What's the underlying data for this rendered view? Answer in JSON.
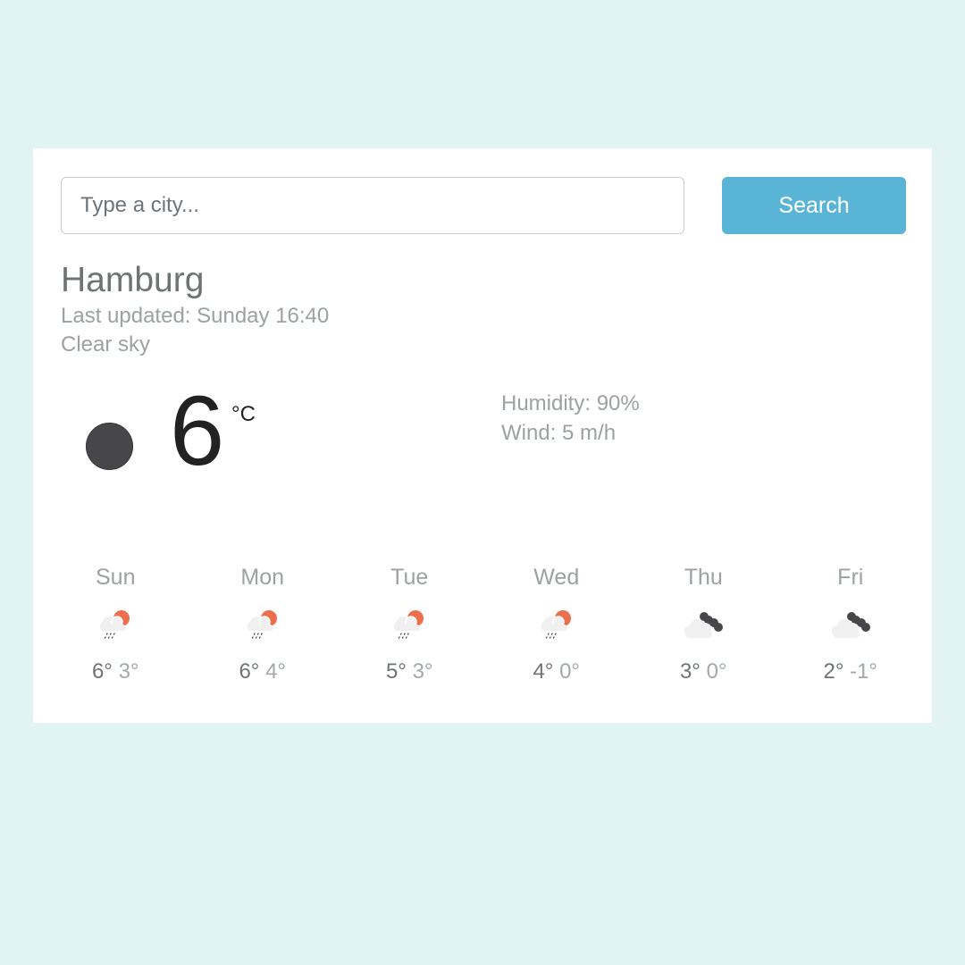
{
  "search": {
    "placeholder": "Type a city...",
    "button_label": "Search"
  },
  "current": {
    "city": "Hamburg",
    "last_updated": "Last updated: Sunday 16:40",
    "description": "Clear sky",
    "icon": "moon-clear-night-icon",
    "temperature": "6",
    "unit": "°C",
    "humidity": "Humidity: 90%",
    "wind": "Wind: 5 m/h"
  },
  "colors": {
    "background": "#e1f4f3",
    "button": "#5ab4d6",
    "sun": "#ec6e4c",
    "dark_cloud": "#474749",
    "light_cloud": "#f0f0f0"
  },
  "forecast": [
    {
      "day": "Sun",
      "max": "6°",
      "min": "3°",
      "icon": "rain-sun-icon"
    },
    {
      "day": "Mon",
      "max": "6°",
      "min": "4°",
      "icon": "rain-sun-icon"
    },
    {
      "day": "Tue",
      "max": "5°",
      "min": "3°",
      "icon": "rain-sun-icon"
    },
    {
      "day": "Wed",
      "max": "4°",
      "min": "0°",
      "icon": "rain-sun-icon"
    },
    {
      "day": "Thu",
      "max": "3°",
      "min": "0°",
      "icon": "broken-clouds-icon"
    },
    {
      "day": "Fri",
      "max": "2°",
      "min": "-1°",
      "icon": "broken-clouds-icon"
    }
  ]
}
